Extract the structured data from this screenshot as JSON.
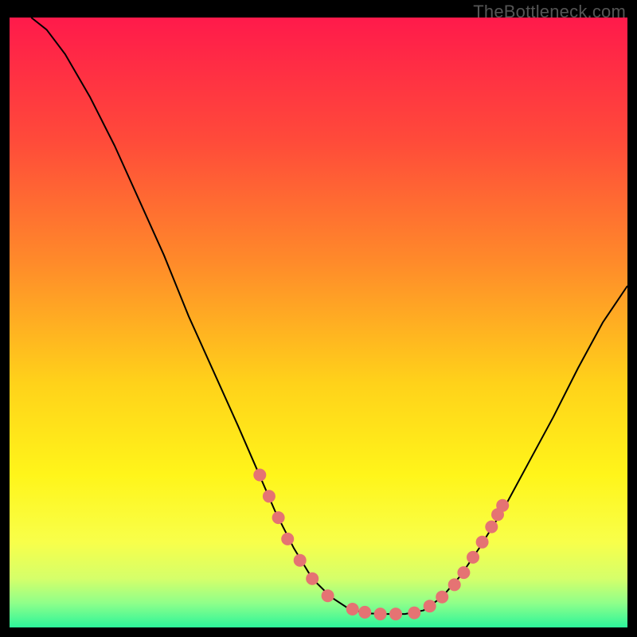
{
  "watermark": "TheBottleneck.com",
  "chart_data": {
    "type": "line",
    "title": "",
    "xlabel": "",
    "ylabel": "",
    "xlim": [
      0,
      1
    ],
    "ylim": [
      0,
      1
    ],
    "gradient_stops": [
      {
        "offset": 0.0,
        "color": "#ff1a4b"
      },
      {
        "offset": 0.2,
        "color": "#ff4a3a"
      },
      {
        "offset": 0.4,
        "color": "#ff8a2a"
      },
      {
        "offset": 0.6,
        "color": "#ffd21a"
      },
      {
        "offset": 0.75,
        "color": "#fff51a"
      },
      {
        "offset": 0.86,
        "color": "#f8ff4a"
      },
      {
        "offset": 0.92,
        "color": "#d5ff6a"
      },
      {
        "offset": 0.96,
        "color": "#8fff8a"
      },
      {
        "offset": 1.0,
        "color": "#2cf59a"
      }
    ],
    "series": [
      {
        "name": "curve",
        "stroke": "#000000",
        "stroke_width": 2,
        "points": [
          {
            "x": 0.035,
            "y": 1.0
          },
          {
            "x": 0.06,
            "y": 0.98
          },
          {
            "x": 0.09,
            "y": 0.94
          },
          {
            "x": 0.13,
            "y": 0.87
          },
          {
            "x": 0.17,
            "y": 0.79
          },
          {
            "x": 0.21,
            "y": 0.7
          },
          {
            "x": 0.25,
            "y": 0.61
          },
          {
            "x": 0.29,
            "y": 0.51
          },
          {
            "x": 0.33,
            "y": 0.42
          },
          {
            "x": 0.37,
            "y": 0.33
          },
          {
            "x": 0.4,
            "y": 0.26
          },
          {
            "x": 0.43,
            "y": 0.19
          },
          {
            "x": 0.46,
            "y": 0.13
          },
          {
            "x": 0.49,
            "y": 0.08
          },
          {
            "x": 0.52,
            "y": 0.05
          },
          {
            "x": 0.55,
            "y": 0.03
          },
          {
            "x": 0.58,
            "y": 0.023
          },
          {
            "x": 0.61,
            "y": 0.022
          },
          {
            "x": 0.64,
            "y": 0.022
          },
          {
            "x": 0.67,
            "y": 0.028
          },
          {
            "x": 0.7,
            "y": 0.05
          },
          {
            "x": 0.73,
            "y": 0.085
          },
          {
            "x": 0.76,
            "y": 0.13
          },
          {
            "x": 0.8,
            "y": 0.195
          },
          {
            "x": 0.84,
            "y": 0.27
          },
          {
            "x": 0.88,
            "y": 0.345
          },
          {
            "x": 0.92,
            "y": 0.425
          },
          {
            "x": 0.96,
            "y": 0.5
          },
          {
            "x": 1.0,
            "y": 0.56
          }
        ]
      }
    ],
    "markers": {
      "name": "highlight-dots",
      "color": "#e57373",
      "radius": 8,
      "points": [
        {
          "x": 0.405,
          "y": 0.25
        },
        {
          "x": 0.42,
          "y": 0.215
        },
        {
          "x": 0.435,
          "y": 0.18
        },
        {
          "x": 0.45,
          "y": 0.145
        },
        {
          "x": 0.47,
          "y": 0.11
        },
        {
          "x": 0.49,
          "y": 0.08
        },
        {
          "x": 0.515,
          "y": 0.052
        },
        {
          "x": 0.555,
          "y": 0.03
        },
        {
          "x": 0.575,
          "y": 0.025
        },
        {
          "x": 0.6,
          "y": 0.022
        },
        {
          "x": 0.625,
          "y": 0.022
        },
        {
          "x": 0.655,
          "y": 0.024
        },
        {
          "x": 0.68,
          "y": 0.035
        },
        {
          "x": 0.7,
          "y": 0.05
        },
        {
          "x": 0.72,
          "y": 0.07
        },
        {
          "x": 0.735,
          "y": 0.09
        },
        {
          "x": 0.75,
          "y": 0.115
        },
        {
          "x": 0.765,
          "y": 0.14
        },
        {
          "x": 0.78,
          "y": 0.165
        },
        {
          "x": 0.79,
          "y": 0.185
        },
        {
          "x": 0.798,
          "y": 0.2
        }
      ]
    }
  }
}
